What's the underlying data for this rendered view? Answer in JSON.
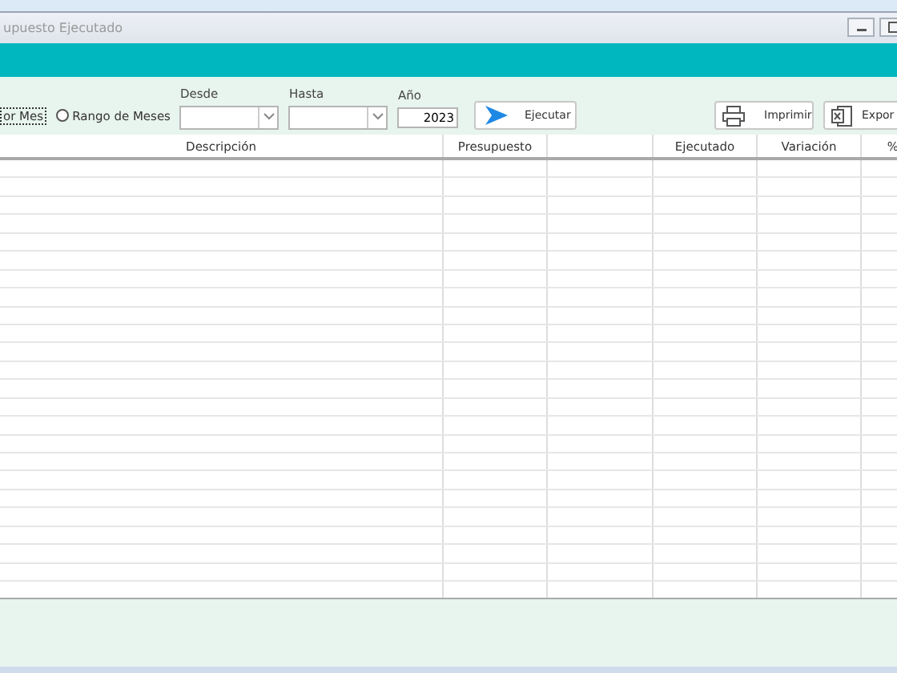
{
  "window": {
    "title": "upuesto Ejecutado"
  },
  "filters": {
    "month_option": {
      "label": "or Mes"
    },
    "range_option": {
      "label": "Rango de Meses",
      "selected": false
    },
    "desde": {
      "label": "Desde"
    },
    "hasta": {
      "label": "Hasta"
    },
    "anio": {
      "label": "Año",
      "value": "2023"
    }
  },
  "buttons": {
    "run": "Ejecutar",
    "print": "Imprimir",
    "export": "Expor"
  },
  "table": {
    "columns": [
      "Descripción",
      "Presupuesto",
      "",
      "Ejecutado",
      "Variación",
      "%"
    ]
  }
}
